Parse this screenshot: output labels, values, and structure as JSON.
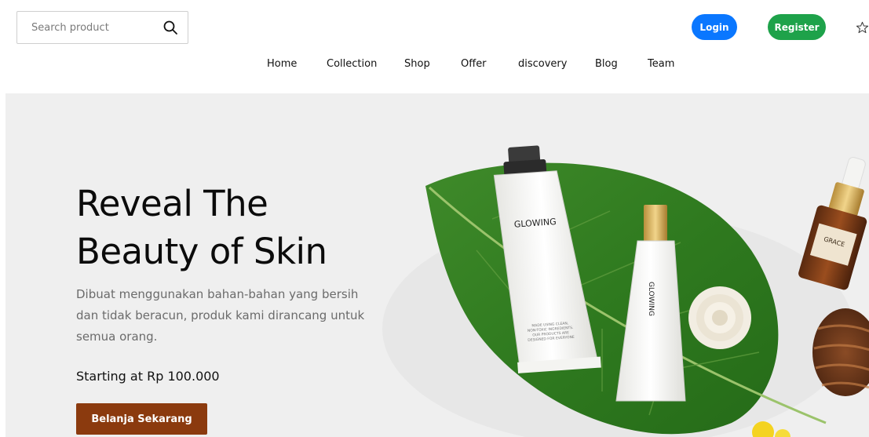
{
  "header": {
    "search": {
      "placeholder": "Search product",
      "value": ""
    },
    "login_label": "Login",
    "register_label": "Register"
  },
  "nav": {
    "items": [
      {
        "label": "Home"
      },
      {
        "label": "Collection"
      },
      {
        "label": "Shop"
      },
      {
        "label": "Offer"
      },
      {
        "label": "discovery"
      },
      {
        "label": "Blog"
      },
      {
        "label": "Team"
      }
    ]
  },
  "hero": {
    "title_line1": "Reveal The",
    "title_line2": "Beauty of Skin",
    "description": "Dibuat menggunakan bahan-bahan yang bersih dan tidak beracun, produk kami dirancang untuk semua orang.",
    "price": "Starting at Rp 100.000",
    "cta_label": "Belanja Sekarang",
    "image": {
      "tube_large_label": "GLOWING",
      "tube_large_small_text": [
        "MADE USING CLEAN,",
        "NON-TOXIC INGREDIENTS.",
        "OUR PRODUCTS ARE",
        "DESIGNED FOR EVERYONE"
      ],
      "tube_small_label": "GLOWING",
      "bottle_label": "GRACE"
    }
  },
  "colors": {
    "login": "#0a77ff",
    "register": "#1ea24a",
    "cta": "#8b3a0e",
    "hero_bg": "#efefef"
  }
}
